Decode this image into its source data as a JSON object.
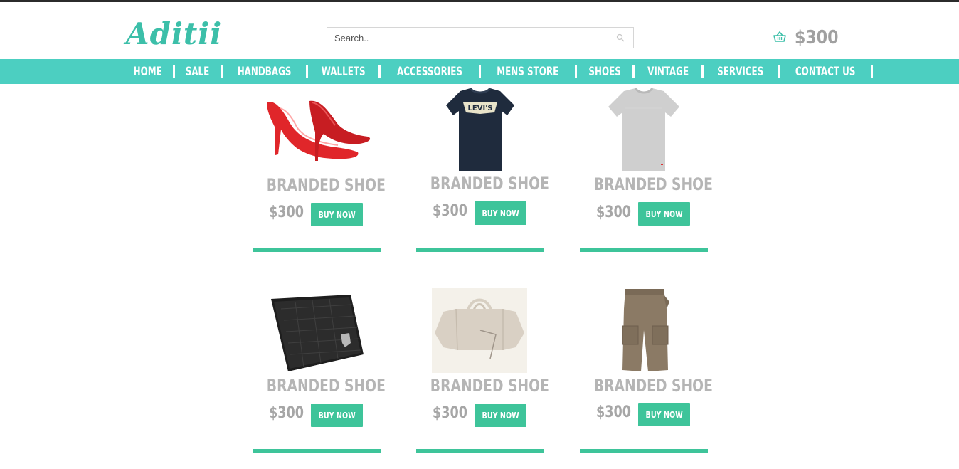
{
  "header": {
    "logo": "Aditii",
    "search_placeholder": "Search..",
    "cart_total": "$300"
  },
  "nav": {
    "items": [
      {
        "label": "HOME"
      },
      {
        "label": "SALE"
      },
      {
        "label": "HANDBAGS"
      },
      {
        "label": "WALLETS"
      },
      {
        "label": "ACCESSORIES"
      },
      {
        "label": "MENS STORE"
      },
      {
        "label": "SHOES"
      },
      {
        "label": "VINTAGE"
      },
      {
        "label": "SERVICES"
      },
      {
        "label": "CONTACT US"
      }
    ]
  },
  "products": [
    {
      "title": "BRANDED SHOE",
      "price": "$300",
      "button": "BUY NOW",
      "image": "red-high-heels-image"
    },
    {
      "title": "BRANDED SHOE",
      "price": "$300",
      "button": "BUY NOW",
      "image": "levis-tshirt-image"
    },
    {
      "title": "BRANDED SHOE",
      "price": "$300",
      "button": "BUY NOW",
      "image": "grey-tshirt-image"
    },
    {
      "title": "BRANDED SHOE",
      "price": "$300",
      "button": "BUY NOW",
      "image": "black-wallet-image"
    },
    {
      "title": "BRANDED SHOE",
      "price": "$300",
      "button": "BUY NOW",
      "image": "beige-handbag-image"
    },
    {
      "title": "BRANDED SHOE",
      "price": "$300",
      "button": "BUY NOW",
      "image": "cargo-shorts-image"
    }
  ],
  "tshirt_print": "LEVI'S",
  "colors": {
    "accent": "#4ccfc1",
    "button": "#3ec49a",
    "logo": "#3cbfa9",
    "muted_text": "#b5b5b5"
  }
}
